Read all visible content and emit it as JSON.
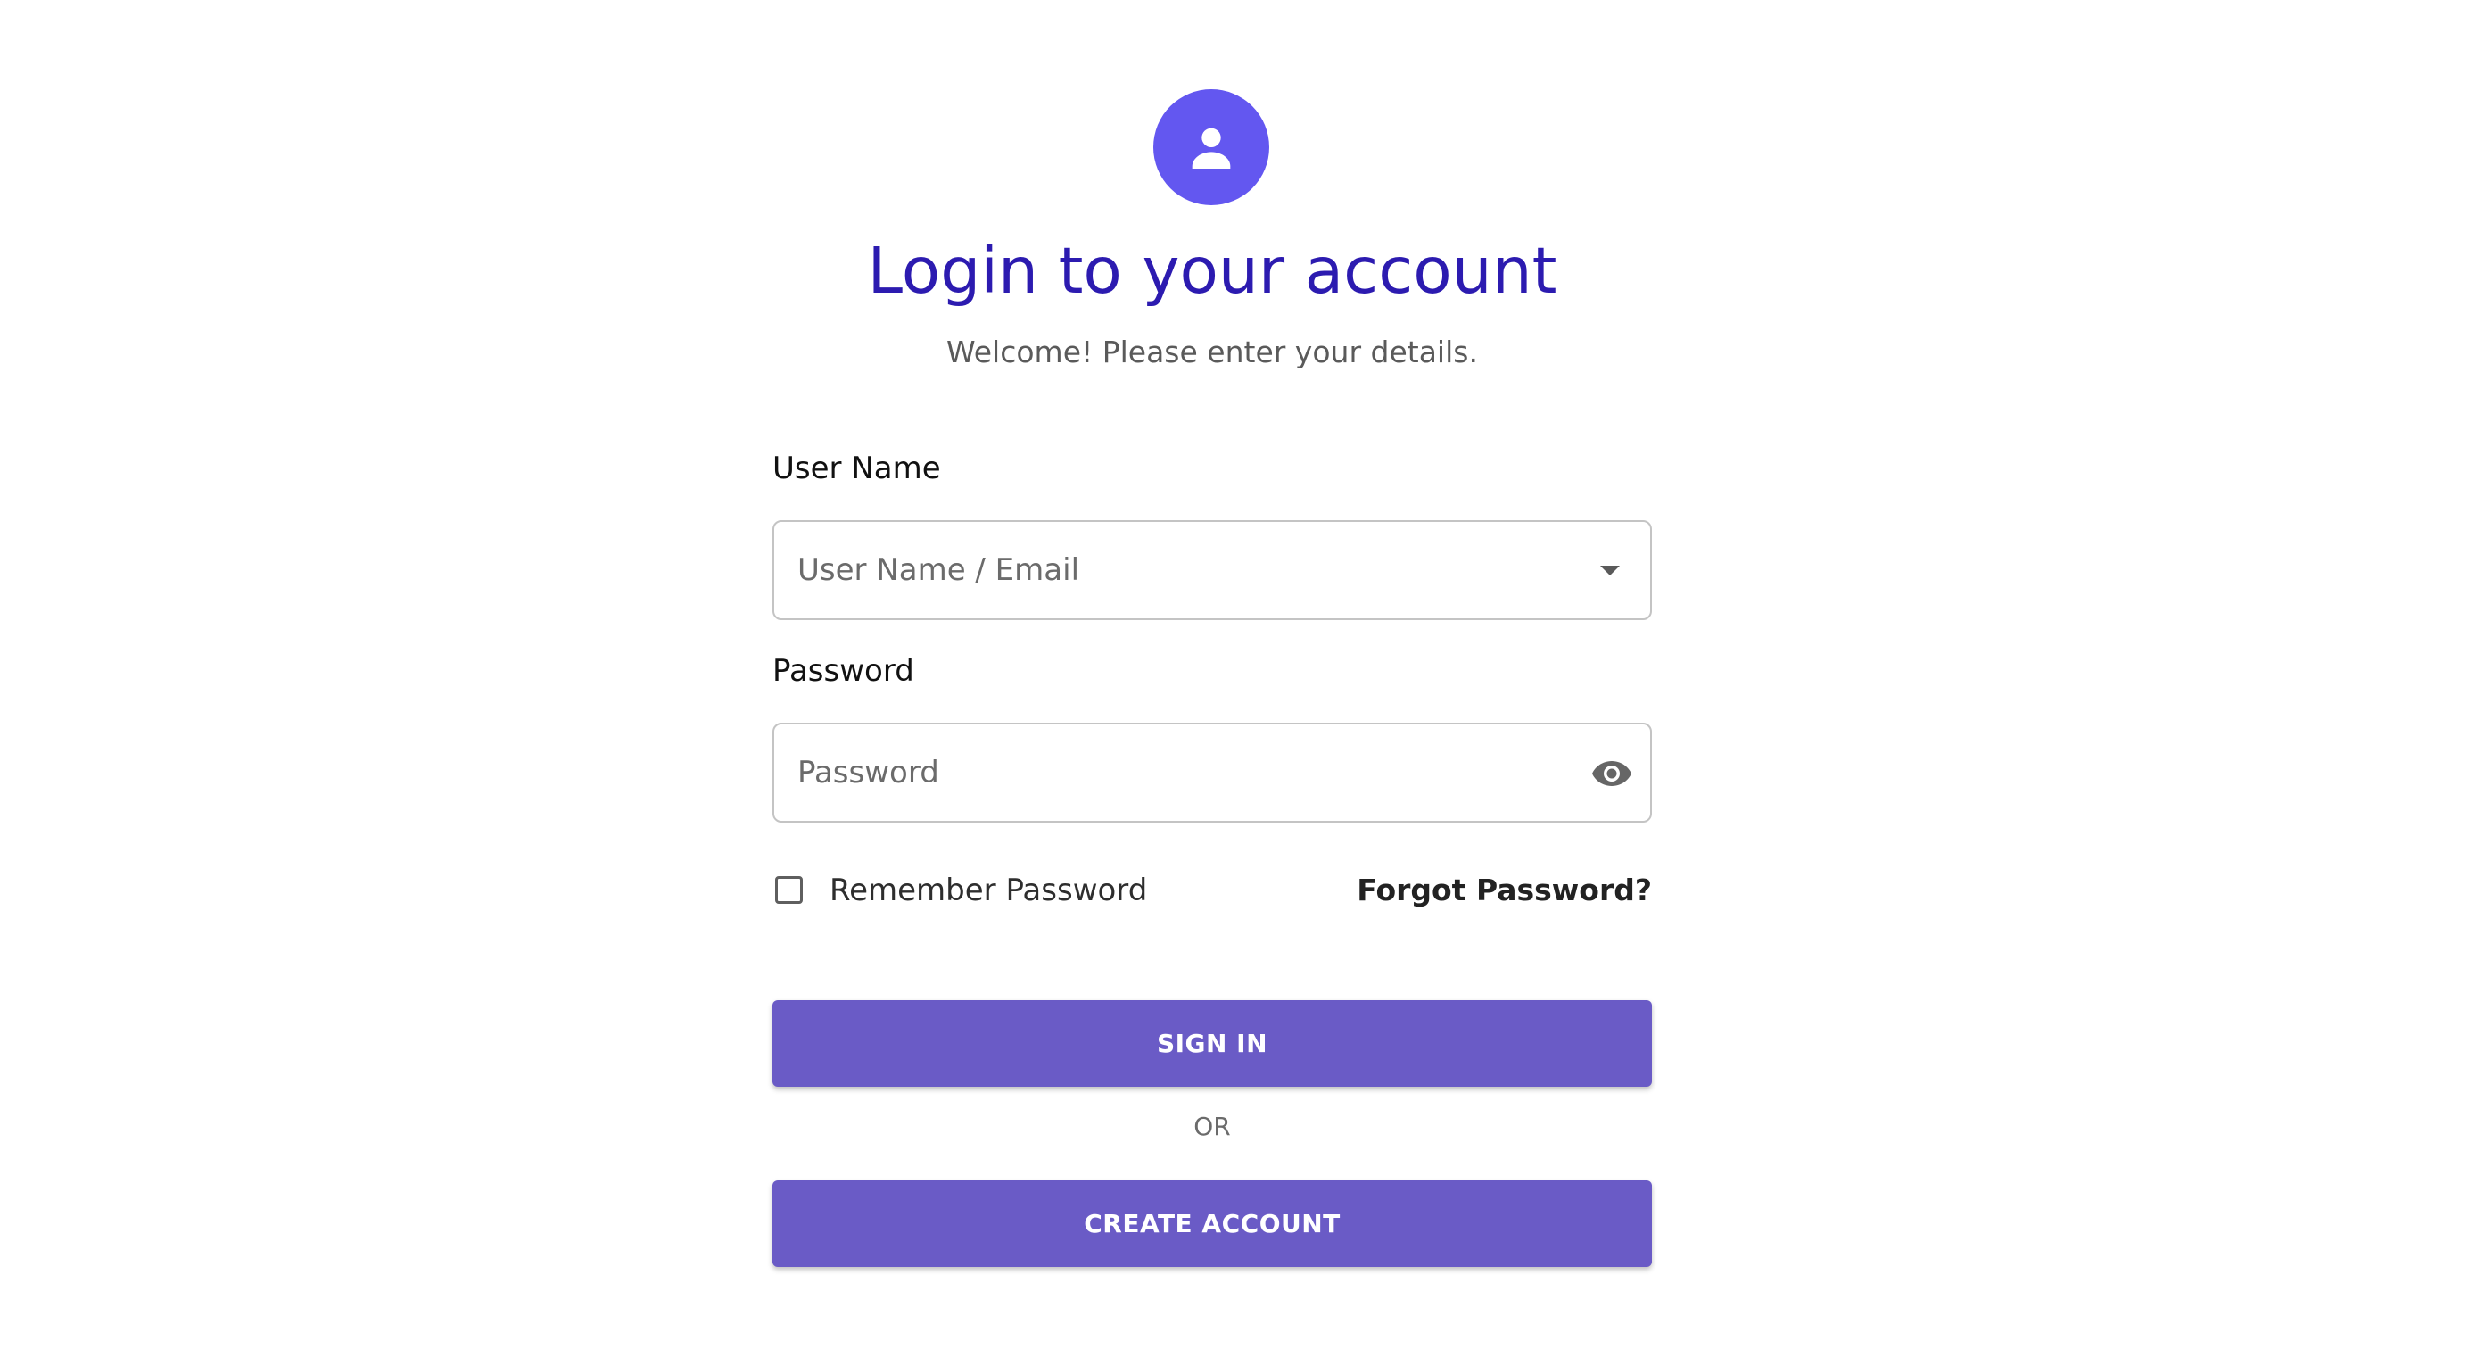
{
  "header": {
    "avatar_icon": "user-icon",
    "title": "Login to your account",
    "subtitle": "Welcome! Please enter your details."
  },
  "form": {
    "username": {
      "label": "User Name",
      "placeholder": "User Name / Email",
      "value": "",
      "trailing_icon": "chevron-down-icon"
    },
    "password": {
      "label": "Password",
      "placeholder": "Password",
      "value": "",
      "trailing_icon": "eye-icon"
    },
    "remember": {
      "label": "Remember Password",
      "checked": false
    },
    "forgot_link": "Forgot Password?"
  },
  "actions": {
    "signin_label": "SIGN IN",
    "separator": "OR",
    "create_label": "CREATE ACCOUNT"
  },
  "colors": {
    "avatar_bg": "#6357f0",
    "title": "#2c1bb0",
    "button_bg": "#6a5bc6"
  }
}
